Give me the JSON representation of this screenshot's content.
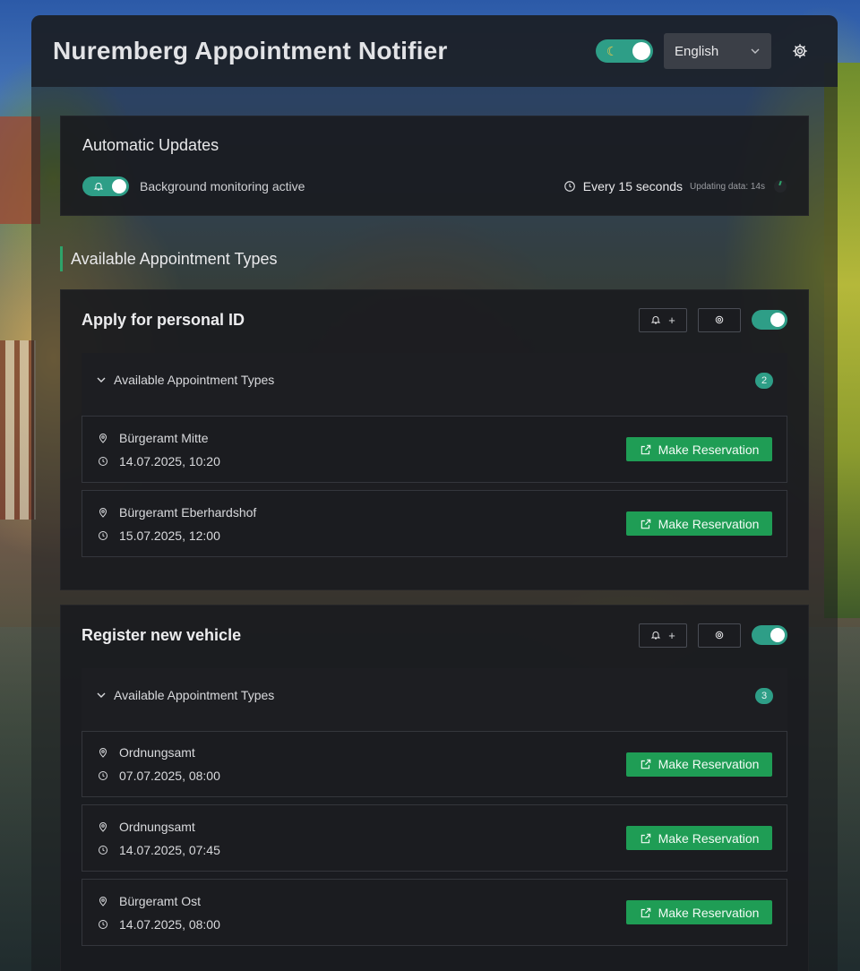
{
  "header": {
    "title": "Nuremberg Appointment Notifier",
    "theme_icon": "moon-icon",
    "language": "English"
  },
  "auto_updates": {
    "title": "Automatic Updates",
    "monitor_label": "Background monitoring active",
    "interval": "Every 15 seconds",
    "updating": "Updating data: 14s"
  },
  "section_title": "Available Appointment Types",
  "services": [
    {
      "title": "Apply for personal ID",
      "bell_plus": "+",
      "avail_label": "Available Appointment Types",
      "count": "2",
      "slots": [
        {
          "location": "Bürgeramt Mitte",
          "datetime": "14.07.2025, 10:20",
          "button": "Make Reservation"
        },
        {
          "location": "Bürgeramt Eberhardshof",
          "datetime": "15.07.2025, 12:00",
          "button": "Make Reservation"
        }
      ]
    },
    {
      "title": "Register new vehicle",
      "bell_plus": "+",
      "avail_label": "Available Appointment Types",
      "count": "3",
      "slots": [
        {
          "location": "Ordnungsamt",
          "datetime": "07.07.2025, 08:00",
          "button": "Make Reservation"
        },
        {
          "location": "Ordnungsamt",
          "datetime": "14.07.2025, 07:45",
          "button": "Make Reservation"
        },
        {
          "location": "Bürgeramt Ost",
          "datetime": "14.07.2025, 08:00",
          "button": "Make Reservation"
        }
      ]
    }
  ],
  "colors": {
    "accent": "#2e9e87",
    "reserve": "#1f9d55",
    "section_bar": "#2ea36a"
  }
}
